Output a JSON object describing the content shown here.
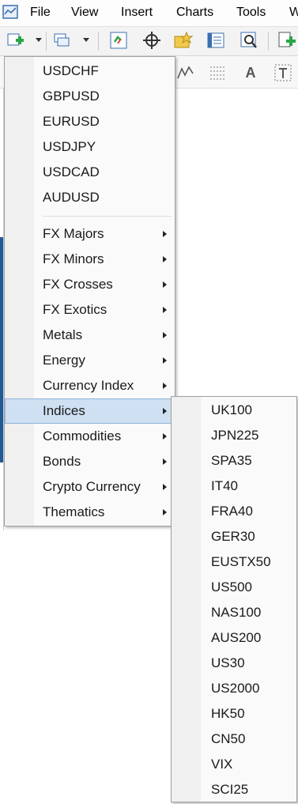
{
  "menubar": {
    "items": [
      {
        "label": "File"
      },
      {
        "label": "View"
      },
      {
        "label": "Insert"
      },
      {
        "label": "Charts"
      },
      {
        "label": "Tools"
      },
      {
        "label": "W"
      }
    ]
  },
  "toolbar": {
    "buttons": [
      "new-chart-icon",
      "profiles-icon",
      "auto-trading-icon",
      "crosshair-icon",
      "favorites-icon",
      "navigator-icon",
      "strategy-tester-icon",
      "new-order-icon"
    ]
  },
  "symbols_menu": {
    "symbols": [
      "USDCHF",
      "GBPUSD",
      "EURUSD",
      "USDJPY",
      "USDCAD",
      "AUDUSD"
    ],
    "groups": [
      {
        "label": "FX Majors"
      },
      {
        "label": "FX Minors"
      },
      {
        "label": "FX Crosses"
      },
      {
        "label": "FX Exotics"
      },
      {
        "label": "Metals"
      },
      {
        "label": "Energy"
      },
      {
        "label": "Currency Index"
      },
      {
        "label": "Indices"
      },
      {
        "label": "Commodities"
      },
      {
        "label": "Bonds"
      },
      {
        "label": "Crypto Currency"
      },
      {
        "label": "Thematics"
      }
    ],
    "highlighted": "Indices"
  },
  "indices_submenu": {
    "items": [
      "UK100",
      "JPN225",
      "SPA35",
      "IT40",
      "FRA40",
      "GER30",
      "EUSTX50",
      "US500",
      "NAS100",
      "AUS200",
      "US30",
      "US2000",
      "HK50",
      "CN50",
      "VIX",
      "SCI25"
    ]
  },
  "colors": {
    "highlight": "#cfe0f2",
    "accent_blue": "#1f5b96"
  }
}
